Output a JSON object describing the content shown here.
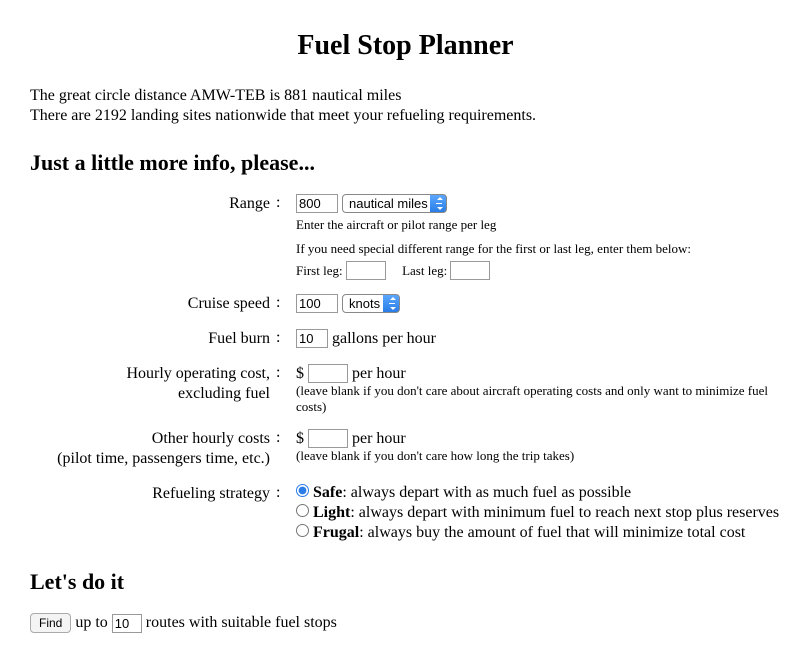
{
  "title": "Fuel Stop Planner",
  "intro": {
    "line1": "The great circle distance AMW-TEB is 881 nautical miles",
    "line2": "There are 2192 landing sites nationwide that meet your refueling requirements."
  },
  "section1_heading": "Just a little more info, please...",
  "range": {
    "label": "Range",
    "value": "800",
    "unit_selected": "nautical miles",
    "hint": "Enter the aircraft or pilot range per leg",
    "special_hint": "If you need special different range for the first or last leg, enter them below:",
    "first_leg_label": "First leg:",
    "first_leg_value": "",
    "last_leg_label": "Last leg:",
    "last_leg_value": ""
  },
  "cruise": {
    "label": "Cruise speed",
    "value": "100",
    "unit_selected": "knots"
  },
  "fuel_burn": {
    "label": "Fuel burn",
    "value": "10",
    "unit_text": "gallons per hour"
  },
  "op_cost": {
    "label_l1": "Hourly operating cost,",
    "label_l2": "excluding fuel",
    "prefix": "$",
    "value": "",
    "unit_text": "per hour",
    "hint": "(leave blank if you don't care about aircraft operating costs and only want to minimize fuel costs)"
  },
  "other_cost": {
    "label_l1": "Other hourly costs",
    "label_l2": "(pilot time, passengers time, etc.)",
    "prefix": "$",
    "value": "",
    "unit_text": "per hour",
    "hint": "(leave blank if you don't care how long the trip takes)"
  },
  "strategy": {
    "label": "Refueling strategy",
    "options": [
      {
        "name": "Safe",
        "desc": ": always depart with as much fuel as possible",
        "checked": true
      },
      {
        "name": "Light",
        "desc": ": always depart with minimum fuel to reach next stop plus reserves",
        "checked": false
      },
      {
        "name": "Frugal",
        "desc": ": always buy the amount of fuel that will minimize total cost",
        "checked": false
      }
    ]
  },
  "section2_heading": "Let's do it",
  "find": {
    "button": "Find",
    "prefix": "up to",
    "value": "10",
    "suffix": "routes with suitable fuel stops"
  }
}
